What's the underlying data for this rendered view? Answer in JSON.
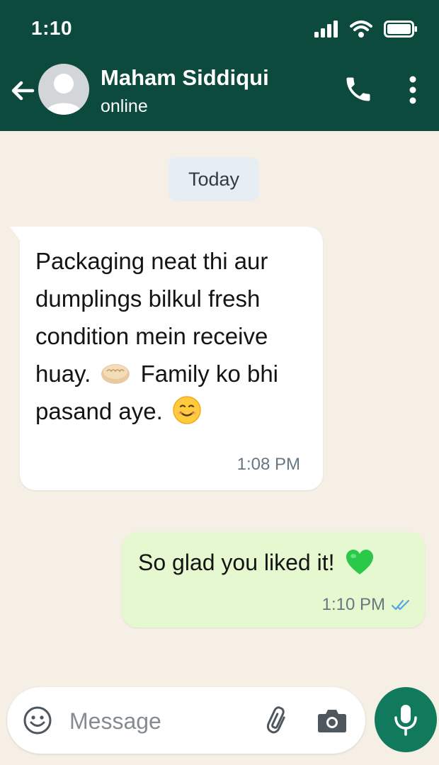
{
  "status_bar": {
    "time": "1:10"
  },
  "header": {
    "contact_name": "Maham Siddiqui",
    "contact_status": "online",
    "icons": [
      "back-arrow-icon",
      "avatar",
      "phone-icon",
      "more-vert-icon"
    ]
  },
  "date_chip": "Today",
  "messages": [
    {
      "direction": "incoming",
      "parts": [
        "Packaging neat thi aur dumplings bilkul fresh condition mein receive huay. ",
        " Family ko bhi pasand aye. "
      ],
      "emojis": [
        "dumpling-emoji",
        "smiling-face-emoji"
      ],
      "time": "1:08 PM"
    },
    {
      "direction": "outgoing",
      "text": "So glad you liked it!",
      "emoji": "green-heart-emoji",
      "time": "1:10 PM",
      "status": "read"
    }
  ],
  "composer": {
    "placeholder": "Message",
    "value": "",
    "icons": [
      "emoji-icon",
      "attach-icon",
      "camera-icon",
      "mic-icon"
    ]
  },
  "colors": {
    "header_bg": "#0b4a3c",
    "chat_bg": "#f6efe6",
    "outgoing_bubble": "#e6f8cf",
    "incoming_bubble": "#ffffff",
    "accent": "#117a5c",
    "read_ticks": "#53a6e6"
  }
}
